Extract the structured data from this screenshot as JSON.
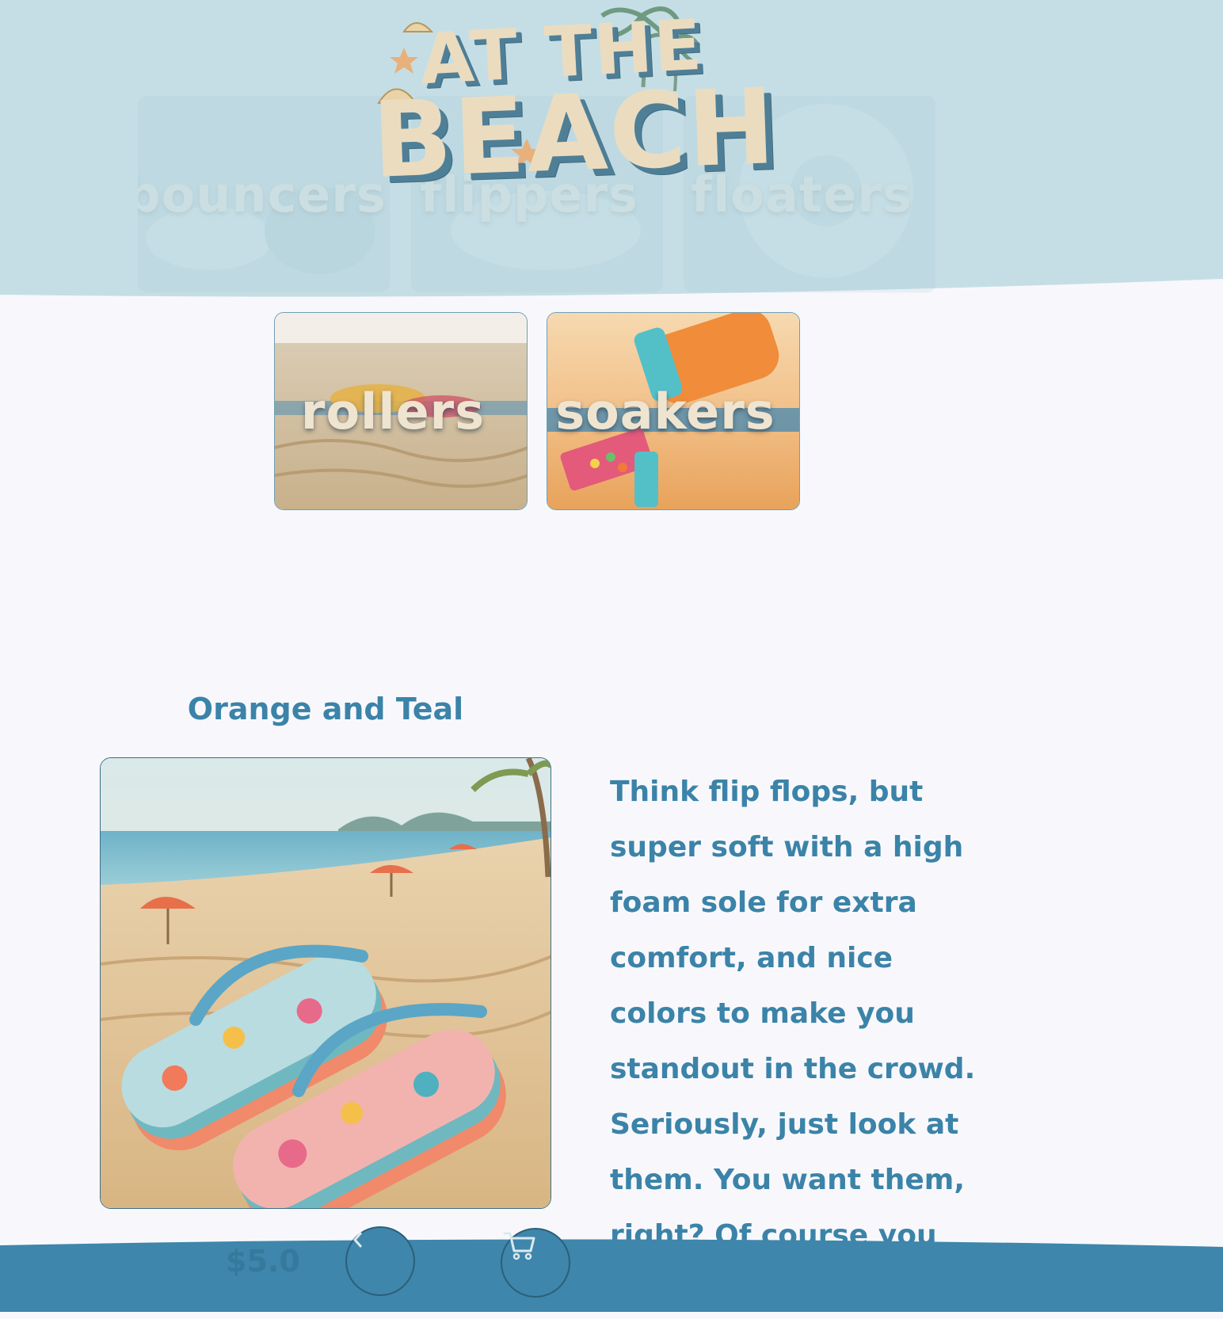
{
  "logo": {
    "line1": "AT THE",
    "line2": "BEACH"
  },
  "categories": [
    {
      "label": "bouncers",
      "state": "faded"
    },
    {
      "label": "flippers",
      "state": "faded"
    },
    {
      "label": "floaters",
      "state": "faded"
    },
    {
      "label": "rollers",
      "state": "visible"
    },
    {
      "label": "soakers",
      "state": "visible"
    }
  ],
  "product": {
    "title": "Orange and Teal",
    "description": "Think flip flops, but super soft with a high foam sole for extra comfort, and nice colors to make you standout in the crowd. Seriously, just look at them. You want them, right? Of course you do.",
    "price_partial": "$5.0"
  },
  "footer": {
    "back_icon": "chevron-icon",
    "cart_icon": "cart-icon"
  },
  "colors": {
    "header_bg": "#c5dee5",
    "page_bg": "#f8f8fc",
    "accent": "#3b83a8",
    "footer_bg": "#3e86ab",
    "sand": "#efe4cf"
  }
}
